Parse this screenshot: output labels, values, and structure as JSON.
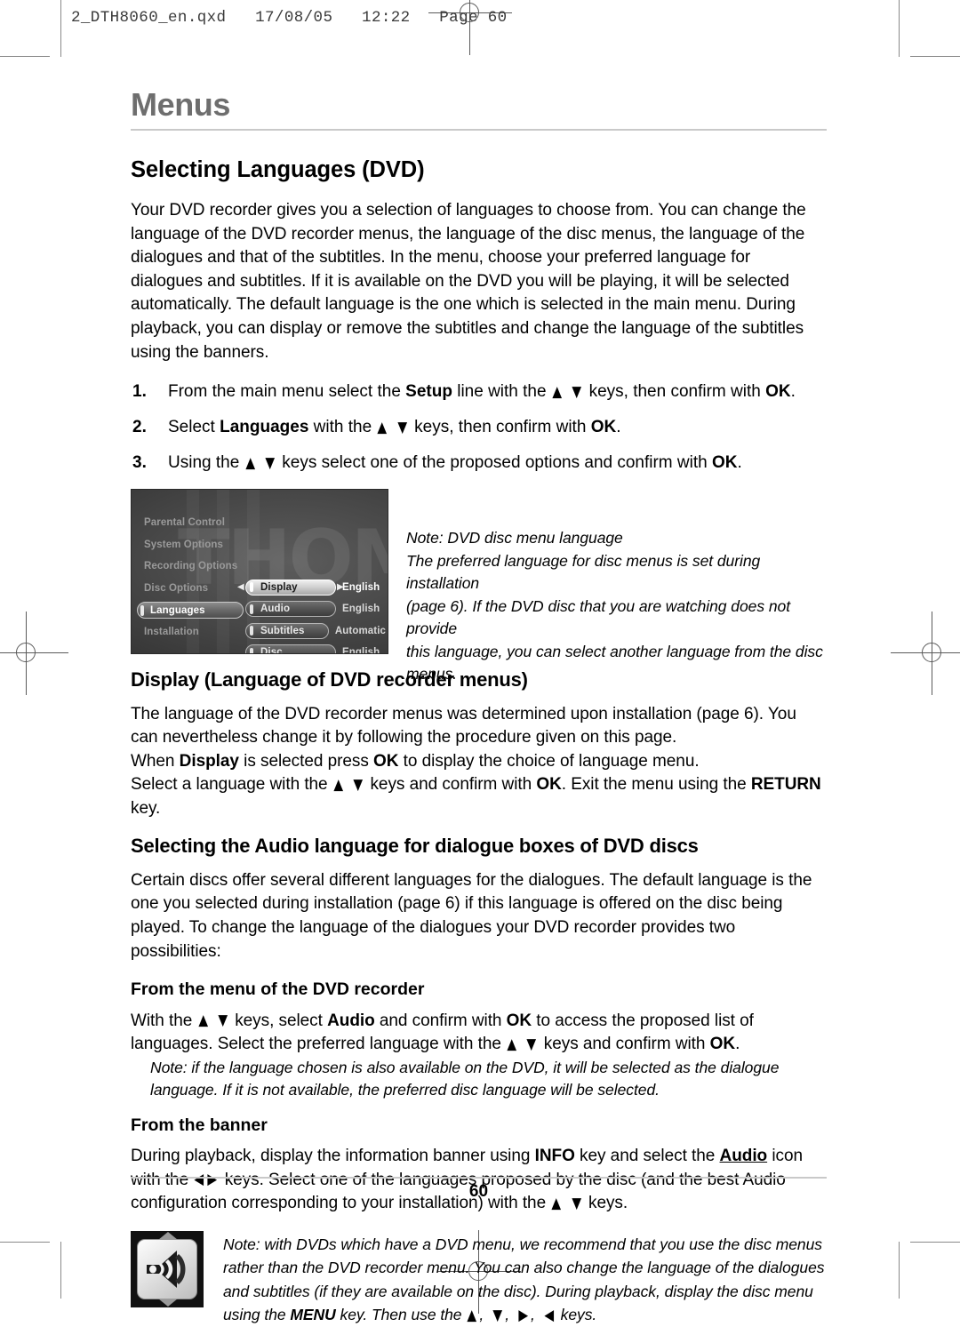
{
  "file_header": "2_DTH8060_en.qxd   17/08/05   12:22   Page 60",
  "chapter": "Menus",
  "title": "Selecting Languages (DVD)",
  "intro": "Your DVD recorder gives you a selection of languages to choose from. You can change the language of the DVD recorder menus, the language of the disc menus, the language of the dialogues and that of the subtitles. In the menu, choose your preferred language for dialogues and subtitles. If it is available on the DVD you will be playing, it will be selected automatically. The default language is the one which is selected in the main menu. During playback, you can display or remove the subtitles and change the language of the subtitles using the banners.",
  "steps": [
    {
      "num": "1.",
      "a": "From the main menu select the ",
      "bold1": "Setup",
      "b": " line with the ",
      "c": " keys, then confirm with ",
      "bold2": "OK",
      "d": "."
    },
    {
      "num": "2.",
      "a": "Select ",
      "bold1": "Languages",
      "b": " with the ",
      "c": " keys, then confirm with ",
      "bold2": "OK",
      "d": "."
    },
    {
      "num": "3.",
      "a": "Using the ",
      "bold1": "",
      "b": "",
      "c": " keys select one of the proposed options and confirm with ",
      "bold2": "OK",
      "d": "."
    }
  ],
  "tv_screen": {
    "watermark": "THOMSON",
    "left_items": [
      {
        "label": "Parental Control",
        "selected": false
      },
      {
        "label": "System Options",
        "selected": false
      },
      {
        "label": "Recording Options",
        "selected": false
      },
      {
        "label": "Disc Options",
        "selected": false
      },
      {
        "label": "Languages",
        "selected": true
      },
      {
        "label": "Installation",
        "selected": false
      }
    ],
    "rows": [
      {
        "label": "Display",
        "value": "English",
        "active": true
      },
      {
        "label": "Audio",
        "value": "English",
        "active": false
      },
      {
        "label": "Subtitles",
        "value": "Automatic",
        "active": false
      },
      {
        "label": "Disc",
        "value": "English",
        "active": false
      }
    ],
    "arrow_left": "◀",
    "arrow_right": "▶"
  },
  "figure_note": [
    "Note: DVD disc menu language",
    "The preferred language for disc menus is set during installation",
    "(page 6). If the DVD disc that you are watching does not provide",
    "this language, you can select another language from the disc menus."
  ],
  "display_section": {
    "heading": "Display (Language of DVD recorder menus)",
    "p1": "The language of the DVD recorder menus was determined upon installation (page 6). You can nevertheless change it by following the procedure given on this page.",
    "p2_a": "When ",
    "p2_bold1": "Display",
    "p2_b": " is selected press ",
    "p2_bold2": "OK",
    "p2_c": " to display the choice of language menu.",
    "p3_a": "Select a language with the ",
    "p3_b": " keys and confirm with ",
    "p3_bold1": "OK",
    "p3_c": ". Exit the menu using the ",
    "p3_bold2": "RETURN",
    "p3_d": " key."
  },
  "audio_section": {
    "heading": "Selecting the Audio language for dialogue boxes of DVD discs",
    "p1": "Certain discs offer several different languages for the dialogues. The default language is the one you selected during installation (page 6) if this language is offered on the disc being played. To change the language of the dialogues your DVD recorder provides two possibilities:"
  },
  "from_menu_section": {
    "heading": "From the menu of the DVD recorder",
    "p_a": "With the ",
    "p_b": " keys, select ",
    "p_bold1": "Audio",
    "p_c": " and confirm with ",
    "p_bold2": "OK",
    "p_d": " to access the proposed list of languages. Select the preferred language with the ",
    "p_e": " keys and confirm with ",
    "p_bold3": "OK",
    "p_f": ".",
    "note": "Note: if the language chosen is also available on the DVD, it will be selected as the dialogue language. If it is not available, the preferred disc language will be selected."
  },
  "from_banner_section": {
    "heading": "From the banner",
    "p_a": "During playback, display the information banner using ",
    "p_bold1": "INFO",
    "p_b": " key and select the ",
    "p_underline": "Audio",
    "p_c": " icon with the ",
    "p_d": " keys. Select one of the languages proposed by the disc (and the best Audio configuration corresponding to your installation) with the ",
    "p_e": " keys."
  },
  "banner_note": {
    "a": "Note: with DVDs which have a DVD menu, we recommend that you use the disc menus rather than the DVD recorder menu. You can also change the language of the dialogues and subtitles (if they are available on the disc). During playback, display the disc menu using the ",
    "bold": "MENU",
    "b": " key. Then use the ",
    "c": " keys."
  },
  "page_number": "60",
  "colors": {
    "chapter_gray": "#6e6e6e",
    "rule_gray": "#c9c9c9",
    "body_black": "#000000",
    "crop_gray": "#5a5a5a"
  }
}
